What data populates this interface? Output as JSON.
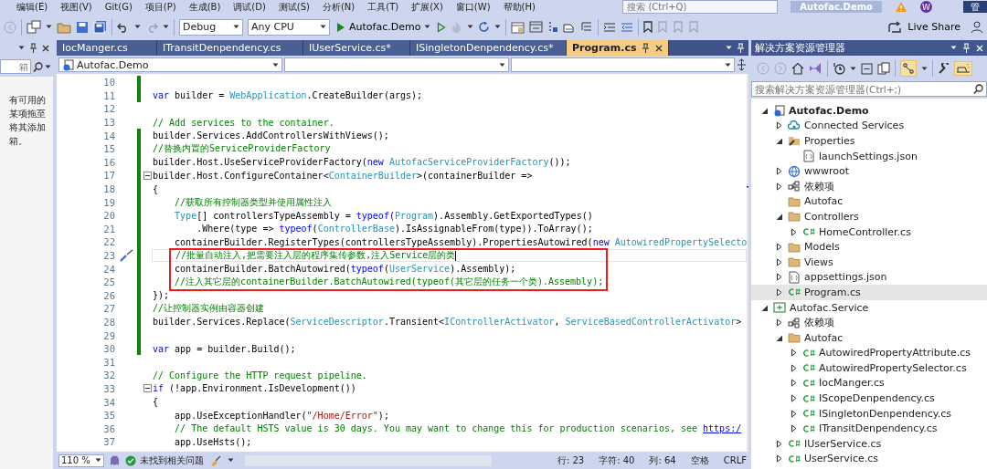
{
  "menu": [
    "编辑(E)",
    "视图(V)",
    "Git(G)",
    "项目(P)",
    "生成(B)",
    "调试(D)",
    "测试(S)",
    "分析(N)",
    "工具(T)",
    "扩展(X)",
    "窗口(W)",
    "帮助(H)"
  ],
  "search": {
    "placeholder": "搜索 (Ctrl+Q)"
  },
  "solution_title": "Autofac.Demo",
  "avatar_initial": "W",
  "admin_button": "管",
  "toolbar": {
    "configuration": "Debug",
    "platform": "Any CPU",
    "start_target": "Autofac.Demo",
    "live_share": "Live Share"
  },
  "toolbox": {
    "placeholder": "箱",
    "message_lines": [
      "有可用的",
      "某项拖至",
      "将其添加",
      "箱。"
    ]
  },
  "editor": {
    "tabs": [
      {
        "label": "IocManger.cs",
        "selected": false
      },
      {
        "label": "ITransitDenpendency.cs",
        "selected": false
      },
      {
        "label": "IUserService.cs*",
        "selected": false
      },
      {
        "label": "ISingletonDenpendency.cs*",
        "selected": false
      },
      {
        "label": "Program.cs",
        "selected": true
      }
    ],
    "navigation": {
      "project": "Autofac.Demo"
    },
    "lines": [
      {
        "number": "10",
        "changed": true
      },
      {
        "number": "11",
        "changed": true,
        "tokens": [
          {
            "kind": "keyword",
            "text": "var"
          },
          {
            "kind": "plain",
            "text": " builder = "
          },
          {
            "kind": "type",
            "text": "WebApplication"
          },
          {
            "kind": "plain",
            "text": ".CreateBuilder(args);"
          }
        ]
      },
      {
        "number": "12",
        "changed": false
      },
      {
        "number": "13",
        "changed": false,
        "tokens": [
          {
            "kind": "comment",
            "text": "// Add services to the container."
          }
        ]
      },
      {
        "number": "14",
        "changed": true,
        "tokens": [
          {
            "kind": "plain",
            "text": "builder.Services.AddControllersWithViews();"
          }
        ]
      },
      {
        "number": "15",
        "changed": true,
        "tokens": [
          {
            "kind": "comment",
            "text": "//替换内置的ServiceProviderFactory"
          }
        ]
      },
      {
        "number": "16",
        "changed": true,
        "tokens": [
          {
            "kind": "plain",
            "text": "builder.Host.UseServiceProviderFactory("
          },
          {
            "kind": "keyword",
            "text": "new"
          },
          {
            "kind": "type",
            "text": " AutofacServiceProviderFactory"
          },
          {
            "kind": "plain",
            "text": "());"
          }
        ]
      },
      {
        "number": "17",
        "changed": true,
        "fold": true,
        "tokens": [
          {
            "kind": "plain",
            "text": "builder.Host.ConfigureContainer<"
          },
          {
            "kind": "type",
            "text": "ContainerBuilder"
          },
          {
            "kind": "plain",
            "text": ">(containerBuilder =>"
          }
        ]
      },
      {
        "number": "18",
        "changed": true,
        "tokens": [
          {
            "kind": "plain",
            "text": "{"
          }
        ]
      },
      {
        "number": "19",
        "changed": true,
        "tokens": [
          {
            "kind": "comment",
            "text": "    //获取所有控制器类型并使用属性注入"
          }
        ]
      },
      {
        "number": "20",
        "changed": true,
        "tokens": [
          {
            "kind": "type",
            "text": "    Type"
          },
          {
            "kind": "plain",
            "text": "[] controllersTypeAssembly = "
          },
          {
            "kind": "keyword",
            "text": "typeof"
          },
          {
            "kind": "plain",
            "text": "("
          },
          {
            "kind": "type",
            "text": "Program"
          },
          {
            "kind": "plain",
            "text": ").Assembly.GetExportedTypes()"
          }
        ]
      },
      {
        "number": "21",
        "changed": true,
        "tokens": [
          {
            "kind": "plain",
            "text": "        .Where(type => "
          },
          {
            "kind": "keyword",
            "text": "typeof"
          },
          {
            "kind": "plain",
            "text": "("
          },
          {
            "kind": "type",
            "text": "ControllerBase"
          },
          {
            "kind": "plain",
            "text": ").IsAssignableFrom(type)).ToArray();"
          }
        ]
      },
      {
        "number": "22",
        "changed": true,
        "tokens": [
          {
            "kind": "plain",
            "text": "    containerBuilder.RegisterTypes(controllersTypeAssembly).PropertiesAutowired("
          },
          {
            "kind": "keyword",
            "text": "new"
          },
          {
            "kind": "type",
            "text": " AutowiredPropertySelecto"
          }
        ]
      },
      {
        "number": "23",
        "changed": true,
        "current": true,
        "quick_action": true,
        "boxed": true,
        "tokens": [
          {
            "kind": "comment",
            "text": "    //批量自动注入,把需要注入层的程序集传参数,注入Service层的类"
          }
        ]
      },
      {
        "number": "24",
        "changed": true,
        "boxed": true,
        "tokens": [
          {
            "kind": "plain",
            "text": "    containerBuilder.BatchAutowired("
          },
          {
            "kind": "keyword",
            "text": "typeof"
          },
          {
            "kind": "plain",
            "text": "("
          },
          {
            "kind": "type",
            "text": "UserService"
          },
          {
            "kind": "plain",
            "text": ").Assembly);"
          }
        ]
      },
      {
        "number": "25",
        "changed": true,
        "boxed": true,
        "tokens": [
          {
            "kind": "comment",
            "text": "    //注入其它层的containerBuilder.BatchAutowired(typeof(其它层的任务一个类).Assembly);"
          }
        ]
      },
      {
        "number": "26",
        "changed": true,
        "tokens": [
          {
            "kind": "plain",
            "text": "});"
          }
        ]
      },
      {
        "number": "27",
        "changed": true,
        "tokens": [
          {
            "kind": "comment",
            "text": "//让控制器实例由容器创建"
          }
        ]
      },
      {
        "number": "28",
        "changed": true,
        "tokens": [
          {
            "kind": "plain",
            "text": "builder.Services.Replace("
          },
          {
            "kind": "type",
            "text": "ServiceDescriptor"
          },
          {
            "kind": "plain",
            "text": ".Transient<"
          },
          {
            "kind": "type",
            "text": "IControllerActivator"
          },
          {
            "kind": "plain",
            "text": ", "
          },
          {
            "kind": "type",
            "text": "ServiceBasedControllerActivator"
          },
          {
            "kind": "plain",
            "text": ">"
          }
        ]
      },
      {
        "number": "29",
        "changed": true
      },
      {
        "number": "30",
        "changed": true,
        "tokens": [
          {
            "kind": "keyword",
            "text": "var"
          },
          {
            "kind": "plain",
            "text": " app = builder.Build();"
          }
        ]
      },
      {
        "number": "31",
        "changed": false
      },
      {
        "number": "32",
        "changed": false,
        "tokens": [
          {
            "kind": "comment",
            "text": "// Configure the HTTP request pipeline."
          }
        ]
      },
      {
        "number": "33",
        "changed": false,
        "fold": true,
        "tokens": [
          {
            "kind": "keyword",
            "text": "if"
          },
          {
            "kind": "plain",
            "text": " (!app.Environment.IsDevelopment())"
          }
        ]
      },
      {
        "number": "34",
        "changed": false,
        "tokens": [
          {
            "kind": "plain",
            "text": "{"
          }
        ]
      },
      {
        "number": "35",
        "changed": false,
        "tokens": [
          {
            "kind": "plain",
            "text": "    app.UseExceptionHandler("
          },
          {
            "kind": "string",
            "text": "\"/Home/Error\""
          },
          {
            "kind": "plain",
            "text": ");"
          }
        ]
      },
      {
        "number": "36",
        "changed": false,
        "tokens": [
          {
            "kind": "comment",
            "text": "    // The default HSTS value is 30 days. You may want to change this for production scenarios, see "
          },
          {
            "kind": "link",
            "text": "https:/"
          }
        ]
      },
      {
        "number": "37",
        "changed": false,
        "tokens": [
          {
            "kind": "plain",
            "text": "    app.UseHsts();"
          }
        ]
      }
    ],
    "status": {
      "zoom": "110 %",
      "issues": "未找到相关问题",
      "line": "行: 23",
      "char": "字符: 40",
      "column": "列: 64",
      "whitespace": "空格",
      "line_ending": "CRLF"
    }
  },
  "solution_explorer": {
    "title": "解决方案资源管理器",
    "placeholder": "搜索解决方案资源管理器(Ctrl+;)",
    "tree": [
      {
        "label": "Autofac.Demo",
        "kind": "web-project",
        "startup": true,
        "expanded": true,
        "selected": false,
        "children": [
          {
            "label": "Connected Services",
            "kind": "cloud",
            "expanded": false,
            "selected": false
          },
          {
            "label": "Properties",
            "kind": "properties",
            "expanded": true,
            "selected": false,
            "children": [
              {
                "label": "launchSettings.json",
                "kind": "json",
                "selected": false
              }
            ]
          },
          {
            "label": "wwwroot",
            "kind": "globe",
            "expanded": false,
            "selected": false
          },
          {
            "label": "依赖项",
            "kind": "dependencies",
            "expanded": false,
            "selected": false
          },
          {
            "label": "Autofac",
            "kind": "folder",
            "selected": false
          },
          {
            "label": "Controllers",
            "kind": "folder",
            "expanded": true,
            "selected": false,
            "children": [
              {
                "label": "HomeController.cs",
                "kind": "csharp",
                "expanded": false,
                "selected": false
              }
            ]
          },
          {
            "label": "Models",
            "kind": "folder",
            "expanded": false,
            "selected": false
          },
          {
            "label": "Views",
            "kind": "folder",
            "expanded": false,
            "selected": false
          },
          {
            "label": "appsettings.json",
            "kind": "json",
            "expanded": false,
            "selected": false
          },
          {
            "label": "Program.cs",
            "kind": "csharp",
            "expanded": false,
            "selected": true
          }
        ]
      },
      {
        "label": "Autofac.Service",
        "kind": "csharp-project",
        "startup": false,
        "expanded": true,
        "selected": false,
        "children": [
          {
            "label": "依赖项",
            "kind": "dependencies",
            "expanded": false,
            "selected": false
          },
          {
            "label": "Autofac",
            "kind": "folder",
            "expanded": true,
            "selected": false,
            "children": [
              {
                "label": "AutowiredPropertyAttribute.cs",
                "kind": "csharp",
                "expanded": false,
                "selected": false
              },
              {
                "label": "AutowiredPropertySelector.cs",
                "kind": "csharp",
                "expanded": false,
                "selected": false
              },
              {
                "label": "IocManger.cs",
                "kind": "csharp",
                "expanded": false,
                "selected": false
              },
              {
                "label": "IScopeDenpendency.cs",
                "kind": "csharp",
                "expanded": false,
                "selected": false
              },
              {
                "label": "ISingletonDenpendency.cs",
                "kind": "csharp",
                "expanded": false,
                "selected": false
              },
              {
                "label": "ITransitDenpendency.cs",
                "kind": "csharp",
                "expanded": false,
                "selected": false
              }
            ]
          },
          {
            "label": "IUserService.cs",
            "kind": "csharp",
            "expanded": false,
            "selected": false
          },
          {
            "label": "UserService.cs",
            "kind": "csharp",
            "expanded": false,
            "selected": false
          }
        ]
      }
    ]
  }
}
